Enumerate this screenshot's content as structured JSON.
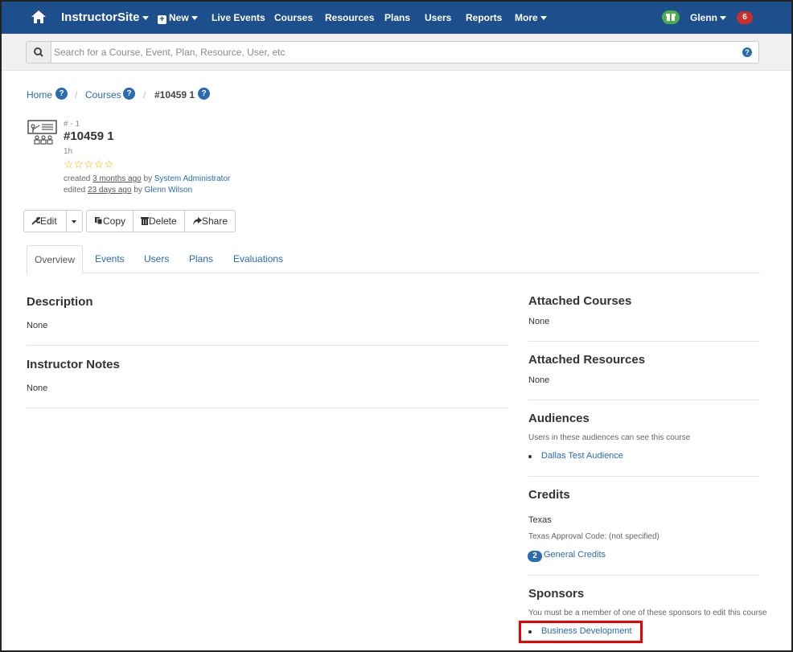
{
  "nav": {
    "brand": "InstructorSite",
    "new_label": "New",
    "items": [
      "Live Events",
      "Courses",
      "Resources",
      "Plans",
      "Users",
      "Reports",
      "More"
    ],
    "user": "Glenn",
    "notifications": "6",
    "icons": {
      "home": "home-icon",
      "gift": "gift-icon"
    },
    "colors": {
      "bar": "#1d4f8c",
      "gift": "#4cae4c",
      "badge": "#c9302c"
    }
  },
  "search": {
    "placeholder": "Search for a Course, Event, Plan, Resource, User, etc",
    "help": "?"
  },
  "breadcrumb": {
    "home": "Home",
    "courses": "Courses",
    "current": "#10459 1",
    "help": "?",
    "sep": "/"
  },
  "course": {
    "subnum": "# - 1",
    "title": "#10459 1",
    "duration": "1h",
    "rating_stars": "☆☆☆☆☆",
    "rating": 0,
    "created_prefix": "created",
    "created_when": "3 months ago",
    "created_by_prefix": "by",
    "created_by": "System Administrator",
    "edited_prefix": "edited",
    "edited_when": "23 days ago",
    "edited_by_prefix": "by",
    "edited_by": "Glenn Wilson"
  },
  "actions": {
    "edit": "Edit",
    "copy": "Copy",
    "delete": "Delete",
    "share": "Share"
  },
  "tabs": [
    "Overview",
    "Events",
    "Users",
    "Plans",
    "Evaluations"
  ],
  "left": {
    "description": {
      "title": "Description",
      "value": "None"
    },
    "instructor_notes": {
      "title": "Instructor Notes",
      "value": "None"
    }
  },
  "right": {
    "attached_courses": {
      "title": "Attached Courses",
      "value": "None"
    },
    "attached_resources": {
      "title": "Attached Resources",
      "value": "None"
    },
    "audiences": {
      "title": "Audiences",
      "note": "Users in these audiences can see this course",
      "items": [
        "Dallas Test Audience"
      ]
    },
    "credits": {
      "title": "Credits",
      "state": "Texas",
      "approval": "Texas Approval Code: (not specified)",
      "count": "2",
      "type": "General Credits"
    },
    "sponsors": {
      "title": "Sponsors",
      "note": "You must be a member of one of these sponsors to edit this course",
      "items": [
        "Business Development"
      ],
      "highlight_color": "#e00000"
    }
  }
}
